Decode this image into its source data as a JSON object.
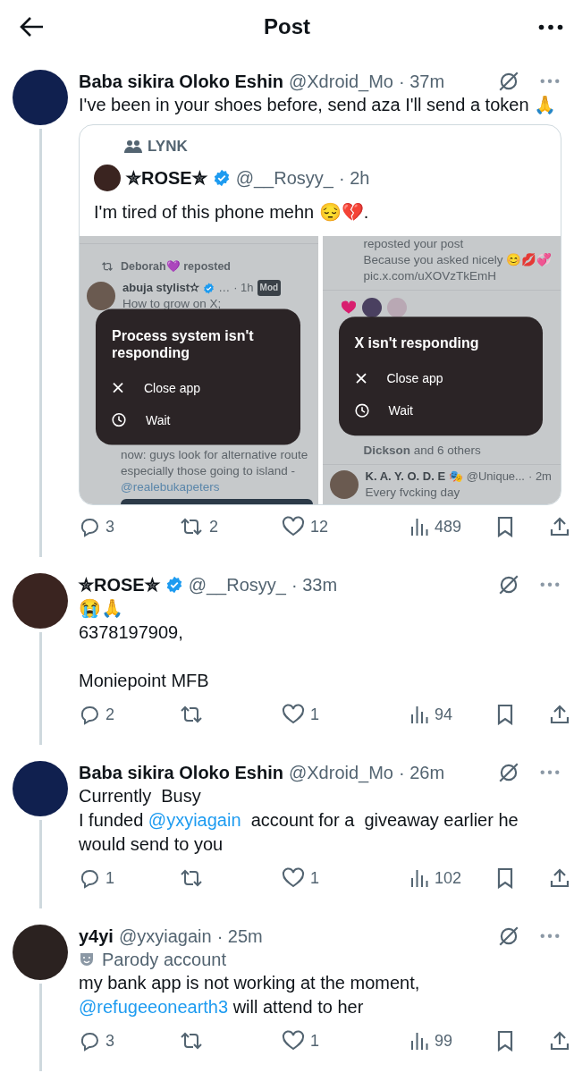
{
  "header": {
    "title": "Post"
  },
  "posts": [
    {
      "name": "Baba sikira Oloko Eshin",
      "handle": "@Xdroid_Mo",
      "time": "· 37m",
      "body": [
        {
          "kind": "plain",
          "text": "I've been in your shoes before, send aza I'll send a token 🙏"
        }
      ],
      "quote": {
        "community": "LYNK",
        "name": "✮ROSE✮",
        "verified": true,
        "handle": "@__Rosyy_",
        "time": "· 2h",
        "body": "I'm tired of this phone mehn 😔💔.",
        "shots": [
          {
            "top": [
              {
                "kind": "repost_note",
                "text": "Deborah💜 reposted"
              },
              {
                "kind": "post_head",
                "name": "abuja stylist✫",
                "verified": true,
                "handle": "…",
                "time": "· 1h",
                "tag": "Mod",
                "text": "How to grow on X;"
              }
            ],
            "bottom": [
              {
                "kind": "text",
                "text": "now: guys look for alternative route especially those going to island -"
              },
              {
                "kind": "link",
                "text": "@realebukapeters"
              },
              {
                "kind": "media"
              }
            ],
            "dialog": {
              "title": "Process system isn't responding",
              "options": [
                {
                  "kind": "close",
                  "label": "Close app"
                },
                {
                  "kind": "wait",
                  "label": "Wait"
                }
              ]
            }
          },
          {
            "top": [
              {
                "kind": "text",
                "text": "reposted your post"
              },
              {
                "kind": "text",
                "text": "Because you asked nicely 😊💋💞"
              },
              {
                "kind": "text",
                "text": "pic.x.com/uXOVzTkEmH"
              },
              {
                "kind": "likers"
              }
            ],
            "bottom": [
              {
                "kind": "text",
                "text": "**Dickson** and 6 others"
              },
              {
                "kind": "post_head",
                "name": "K. A. Y. O. D. E 🎭",
                "handle": "@Unique...",
                "time": "· 2m",
                "text": "Every fvcking day"
              }
            ],
            "dialog": {
              "title": "X isn't responding",
              "options": [
                {
                  "kind": "close",
                  "label": "Close app"
                },
                {
                  "kind": "wait",
                  "label": "Wait"
                }
              ]
            }
          }
        ]
      },
      "stats": [
        {
          "kind": "reply",
          "count": "3"
        },
        {
          "kind": "repost",
          "count": "2"
        },
        {
          "kind": "like",
          "count": "12"
        },
        {
          "kind": "views",
          "count": "489"
        },
        {
          "kind": "bookmark"
        },
        {
          "kind": "share"
        }
      ]
    },
    {
      "name": "✮ROSE✮",
      "handle": "@__Rosyy_",
      "time": "· 33m",
      "verified": true,
      "body": [
        {
          "kind": "plain",
          "text": "😭🙏\n6378197909,\n\nMoniepoint MFB"
        }
      ],
      "stats": [
        {
          "kind": "reply",
          "count": "2"
        },
        {
          "kind": "repost"
        },
        {
          "kind": "like",
          "count": "1"
        },
        {
          "kind": "views",
          "count": "94"
        },
        {
          "kind": "bookmark"
        },
        {
          "kind": "share"
        }
      ]
    },
    {
      "name": "Baba sikira Oloko Eshin",
      "handle": "@Xdroid_Mo",
      "time": "· 26m",
      "body": [
        {
          "kind": "plain",
          "text": "Currently  Busy\nI funded "
        },
        {
          "kind": "mention",
          "text": "@yxyiagain"
        },
        {
          "kind": "plain",
          "text": "  account for a  giveaway earlier he would send to you"
        }
      ],
      "stats": [
        {
          "kind": "reply",
          "count": "1"
        },
        {
          "kind": "repost"
        },
        {
          "kind": "like",
          "count": "1"
        },
        {
          "kind": "views",
          "count": "102"
        },
        {
          "kind": "bookmark"
        },
        {
          "kind": "share"
        }
      ]
    },
    {
      "name": "y4yi",
      "handle": "@yxyiagain",
      "time": "· 25m",
      "label": "Parody account",
      "body": [
        {
          "kind": "plain",
          "text": "my bank app is not working at the moment,\n"
        },
        {
          "kind": "mention",
          "text": "@refugeeonearth3"
        },
        {
          "kind": "plain",
          "text": " will attend to her"
        }
      ],
      "stats": [
        {
          "kind": "reply",
          "count": "3"
        },
        {
          "kind": "repost"
        },
        {
          "kind": "like",
          "count": "1"
        },
        {
          "kind": "views",
          "count": "99"
        },
        {
          "kind": "bookmark"
        },
        {
          "kind": "share"
        }
      ]
    }
  ]
}
